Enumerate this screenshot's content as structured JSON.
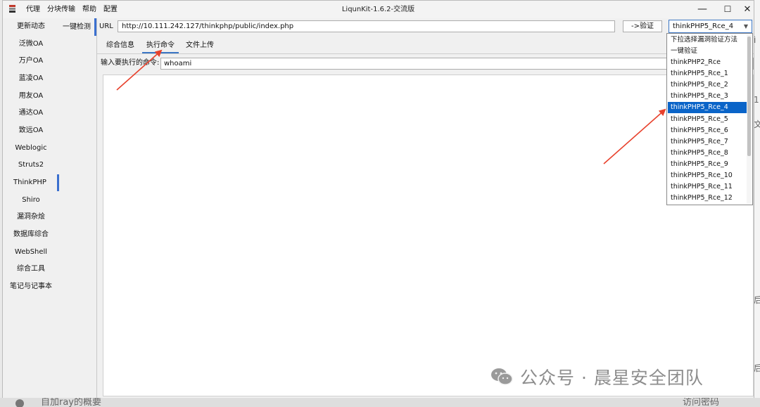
{
  "window": {
    "title": "LiqunKit-1.6.2-交流版",
    "controls": {
      "minimize": "—",
      "maximize": "☐",
      "close": "✕"
    }
  },
  "menu": [
    "代理",
    "分块传输",
    "帮助",
    "配置"
  ],
  "sidebar": {
    "items": [
      {
        "label": "更新动态"
      },
      {
        "label": "泛微OA"
      },
      {
        "label": "万户OA"
      },
      {
        "label": "蓝凌OA"
      },
      {
        "label": "用友OA"
      },
      {
        "label": "通达OA"
      },
      {
        "label": "致远OA"
      },
      {
        "label": "Weblogic"
      },
      {
        "label": "Struts2"
      },
      {
        "label": "ThinkPHP",
        "active": true
      },
      {
        "label": "Shiro"
      },
      {
        "label": "漏洞杂烩"
      },
      {
        "label": "数据库综合"
      },
      {
        "label": "WebShell"
      },
      {
        "label": "综合工具"
      },
      {
        "label": "笔记与记事本"
      }
    ]
  },
  "subnav": {
    "label": "一键检测"
  },
  "toolbar": {
    "url_label": "URL",
    "url_value": "http://10.111.242.127/thinkphp/public/index.php",
    "verify_button": "->验证",
    "method_selected": "thinkPHP5_Rce_4"
  },
  "tabs": [
    {
      "label": "综合信息"
    },
    {
      "label": "执行命令",
      "active": true
    },
    {
      "label": "文件上传"
    }
  ],
  "command": {
    "label": "输入要执行的命令:",
    "value": "whoami"
  },
  "dropdown": {
    "options": [
      "下拉选择漏洞验证方法",
      "一键验证",
      "thinkPHP2_Rce",
      "thinkPHP5_Rce_1",
      "thinkPHP5_Rce_2",
      "thinkPHP5_Rce_3",
      "thinkPHP5_Rce_4",
      "thinkPHP5_Rce_5",
      "thinkPHP5_Rce_6",
      "thinkPHP5_Rce_7",
      "thinkPHP5_Rce_8",
      "thinkPHP5_Rce_9",
      "thinkPHP5_Rce_10",
      "thinkPHP5_Rce_11",
      "thinkPHP5_Rce_12"
    ],
    "selected_index": 6
  },
  "watermark": "公众号 · 晨星安全团队",
  "background_window": {
    "right_glyphs": [
      "ì",
      "1",
      "文",
      "后",
      "后"
    ],
    "bottom_left": "自加ray的概要",
    "bottom_right": "访问密码"
  },
  "colors": {
    "accent": "#3a75c4",
    "selection": "#0a64c8",
    "annotation_arrow": "#e8412c"
  }
}
